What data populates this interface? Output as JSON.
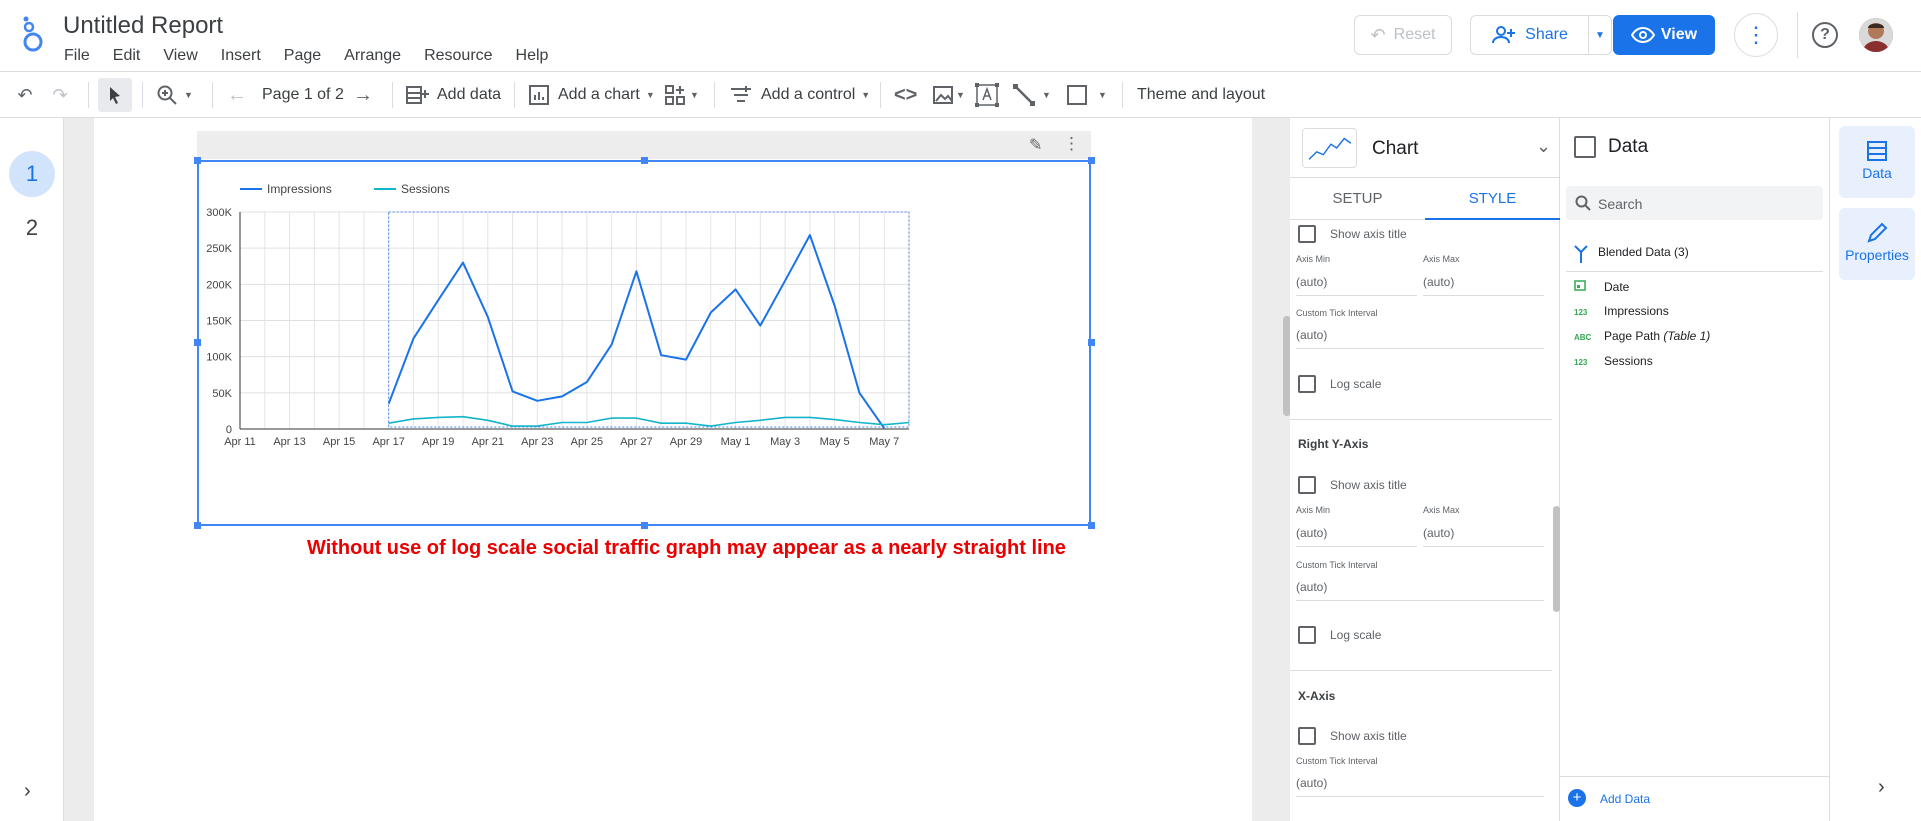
{
  "header": {
    "title": "Untitled Report",
    "menus": [
      "File",
      "Edit",
      "View",
      "Insert",
      "Page",
      "Arrange",
      "Resource",
      "Help"
    ],
    "reset_label": "Reset",
    "share_label": "Share",
    "view_label": "View"
  },
  "toolbar": {
    "page_indicator": "Page 1 of 2",
    "add_data": "Add data",
    "add_chart": "Add a chart",
    "add_control": "Add a control",
    "theme": "Theme and layout"
  },
  "pages": [
    "1",
    "2"
  ],
  "chart_note": "Without use of log scale social traffic graph may appear as a nearly straight line",
  "chart_data": {
    "type": "line",
    "categories": [
      "Apr 11",
      "Apr 12",
      "Apr 13",
      "Apr 14",
      "Apr 15",
      "Apr 16",
      "Apr 17",
      "Apr 18",
      "Apr 19",
      "Apr 20",
      "Apr 21",
      "Apr 22",
      "Apr 23",
      "Apr 24",
      "Apr 25",
      "Apr 26",
      "Apr 27",
      "Apr 28",
      "Apr 29",
      "Apr 30",
      "May 1",
      "May 2",
      "May 3",
      "May 4",
      "May 5",
      "May 6",
      "May 7",
      "May 8"
    ],
    "tick_labels": [
      "Apr 11",
      "Apr 13",
      "Apr 15",
      "Apr 17",
      "Apr 19",
      "Apr 21",
      "Apr 23",
      "Apr 25",
      "Apr 27",
      "Apr 29",
      "May 1",
      "May 3",
      "May 5",
      "May 7"
    ],
    "y_ticks": [
      "300K",
      "250K",
      "200K",
      "150K",
      "100K",
      "50K",
      "0"
    ],
    "ylim": [
      0,
      300000
    ],
    "series": [
      {
        "name": "Impressions",
        "color": "#1a73e8",
        "values": [
          null,
          null,
          null,
          null,
          null,
          null,
          35000,
          125000,
          178000,
          230000,
          155000,
          52000,
          39000,
          45000,
          65000,
          117000,
          218000,
          102000,
          96000,
          161000,
          193000,
          143000,
          205000,
          268000,
          170000,
          50000,
          1000,
          null
        ]
      },
      {
        "name": "Sessions",
        "color": "#12b5cb",
        "values": [
          null,
          null,
          null,
          null,
          null,
          null,
          8000,
          14000,
          16000,
          17000,
          12000,
          4000,
          4000,
          9000,
          9000,
          15000,
          15000,
          8000,
          8000,
          4000,
          9000,
          12000,
          16000,
          16000,
          13000,
          9000,
          6000,
          9000
        ]
      }
    ],
    "legend_position": "top-left",
    "grid": true
  },
  "style_panel": {
    "header_title": "Chart",
    "tabs": [
      "SETUP",
      "STYLE"
    ],
    "show_axis_title": "Show axis title",
    "axis_min": "Axis Min",
    "axis_max": "Axis Max",
    "auto": "(auto)",
    "custom_tick": "Custom Tick Interval",
    "log_scale": "Log scale",
    "right_y_axis": "Right Y-Axis",
    "x_axis": "X-Axis"
  },
  "data_panel": {
    "title": "Data",
    "search_placeholder": "Search",
    "source": "Blended Data (3)",
    "fields": [
      {
        "type": "date",
        "label": "Date"
      },
      {
        "type": "123",
        "label": "Impressions"
      },
      {
        "type": "ABC",
        "label": "Page Path",
        "suffix": "(Table 1)"
      },
      {
        "type": "123",
        "label": "Sessions"
      }
    ],
    "add_data": "Add Data"
  },
  "rail": {
    "data_label": "Data",
    "properties_label": "Properties"
  }
}
